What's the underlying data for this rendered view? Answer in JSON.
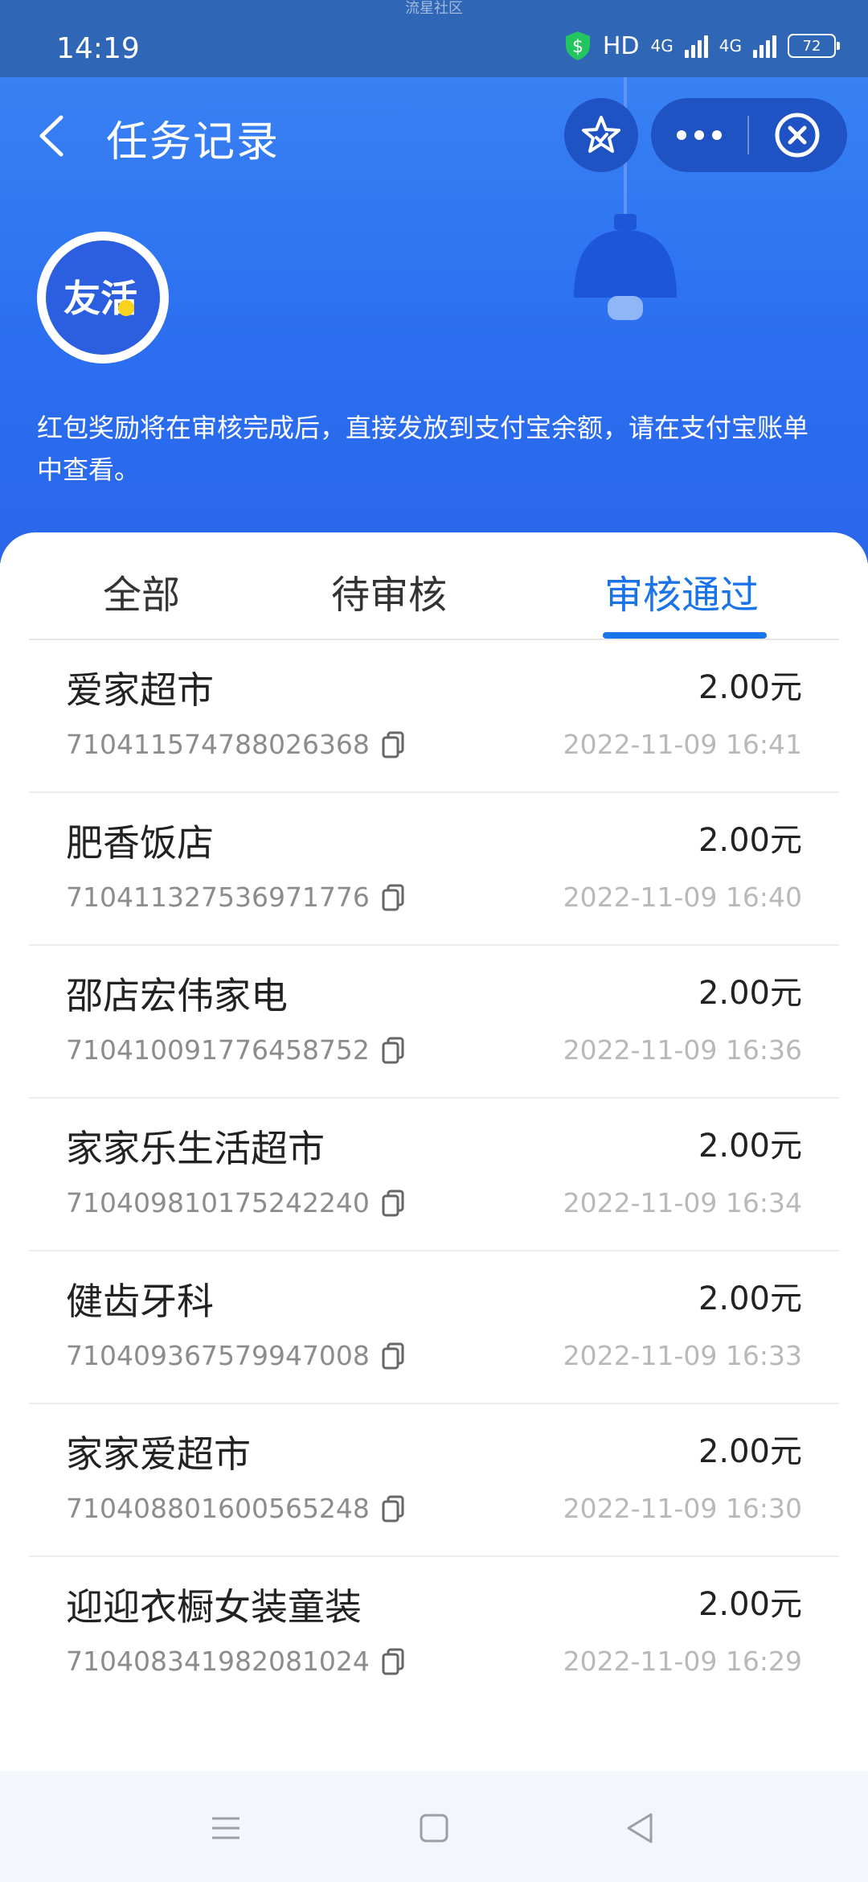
{
  "status": {
    "watermark": "流星社区",
    "time": "14:19",
    "hd": "HD",
    "net1": "4G",
    "net2": "4G",
    "battery": "72"
  },
  "header": {
    "title": "任务记录"
  },
  "logo_text": "友活",
  "notice": "红包奖励将在审核完成后，直接发放到支付宝余额，请在支付宝账单中查看。",
  "tabs": [
    "全部",
    "待审核",
    "审核通过"
  ],
  "active_tab": "审核通过",
  "records": [
    {
      "name": "爱家超市",
      "amount": "2.00元",
      "order": "710411574788026368",
      "time": "2022-11-09 16:41"
    },
    {
      "name": "肥香饭店",
      "amount": "2.00元",
      "order": "710411327536971776",
      "time": "2022-11-09 16:40"
    },
    {
      "name": "邵店宏伟家电",
      "amount": "2.00元",
      "order": "710410091776458752",
      "time": "2022-11-09 16:36"
    },
    {
      "name": "家家乐生活超市",
      "amount": "2.00元",
      "order": "710409810175242240",
      "time": "2022-11-09 16:34"
    },
    {
      "name": "健齿牙科",
      "amount": "2.00元",
      "order": "710409367579947008",
      "time": "2022-11-09 16:33"
    },
    {
      "name": "家家爱超市",
      "amount": "2.00元",
      "order": "710408801600565248",
      "time": "2022-11-09 16:30"
    },
    {
      "name": "迎迎衣橱女装童装",
      "amount": "2.00元",
      "order": "710408341982081024",
      "time": "2022-11-09 16:29"
    }
  ],
  "icons": {
    "back": "chevron-left-icon",
    "favorite": "star-icon",
    "more": "more-dots-icon",
    "close": "close-circle-icon",
    "copy": "copy-icon",
    "nav_menu": "menu-icon",
    "nav_home": "home-icon",
    "nav_back": "back-triangle-icon"
  },
  "colors": {
    "accent": "#1a73e8",
    "header_bg": "#2b6ff0"
  }
}
